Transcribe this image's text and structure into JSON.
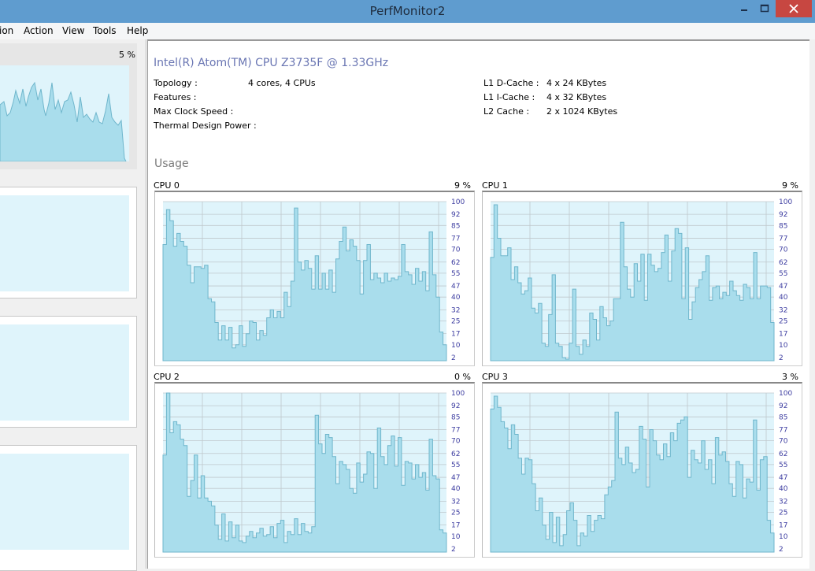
{
  "window": {
    "title": "PerfMonitor2"
  },
  "menu": {
    "items": [
      "ion",
      "Action",
      "View",
      "Tools",
      "Help"
    ]
  },
  "sidebar": {
    "panels": [
      {
        "percent": "5 %"
      }
    ]
  },
  "cpu": {
    "name": "Intel(R) Atom(TM) CPU  Z3735F @ 1.33GHz",
    "specs_left": [
      {
        "label": "Topology :",
        "value": "4 cores, 4 CPUs"
      },
      {
        "label": "Features :",
        "value": ""
      },
      {
        "label": "Max Clock Speed :",
        "value": ""
      },
      {
        "label": "Thermal Design Power :",
        "value": ""
      }
    ],
    "specs_right": [
      {
        "label": "L1 D-Cache :",
        "value": "4 x 24 KBytes"
      },
      {
        "label": "L1 I-Cache :",
        "value": "4 x 32 KBytes"
      },
      {
        "label": "L2 Cache :",
        "value": "2 x 1024 KBytes"
      }
    ]
  },
  "usage": {
    "title": "Usage",
    "y_ticks": [
      "100",
      "92",
      "85",
      "77",
      "70",
      "62",
      "55",
      "47",
      "40",
      "32",
      "25",
      "17",
      "10",
      "2"
    ],
    "cores": [
      {
        "label": "CPU 0",
        "percent": "9 %"
      },
      {
        "label": "CPU 1",
        "percent": "9 %"
      },
      {
        "label": "CPU 2",
        "percent": "0 %"
      },
      {
        "label": "CPU 3",
        "percent": "3 %"
      }
    ]
  },
  "colors": {
    "fill": "#a9ddec",
    "line": "#6fb6cc",
    "bg": "#dff4fb",
    "grid": "#bfc8cc",
    "titlebar": "#5f9ccf",
    "close": "#c74741"
  },
  "chart_data": [
    {
      "type": "area",
      "title": "CPU 0",
      "ylim": [
        0,
        100
      ],
      "y_ticks": [
        100,
        92,
        85,
        77,
        70,
        62,
        55,
        47,
        40,
        32,
        25,
        17,
        10,
        2
      ],
      "values": [
        73,
        95,
        88,
        72,
        80,
        75,
        72,
        60,
        49,
        59,
        59,
        58,
        60,
        39,
        37,
        24,
        13,
        22,
        13,
        21,
        8,
        10,
        22,
        9,
        17,
        25,
        24,
        13,
        19,
        16,
        27,
        32,
        27,
        31,
        27,
        43,
        34,
        50,
        96,
        62,
        57,
        63,
        58,
        45,
        66,
        45,
        55,
        45,
        57,
        43,
        64,
        75,
        84,
        69,
        76,
        72,
        63,
        42,
        63,
        73,
        51,
        55,
        52,
        49,
        55,
        50,
        52,
        51,
        53,
        73,
        56,
        54,
        48,
        58,
        50,
        56,
        44,
        81,
        54,
        40,
        18,
        10
      ]
    },
    {
      "type": "area",
      "title": "CPU 1",
      "ylim": [
        0,
        100
      ],
      "y_ticks": [
        100,
        92,
        85,
        77,
        70,
        62,
        55,
        47,
        40,
        32,
        25,
        17,
        10,
        2
      ],
      "values": [
        65,
        98,
        77,
        66,
        66,
        71,
        51,
        59,
        49,
        42,
        44,
        52,
        33,
        30,
        36,
        11,
        9,
        29,
        54,
        11,
        9,
        2,
        1,
        11,
        45,
        9,
        4,
        13,
        9,
        30,
        26,
        13,
        34,
        27,
        22,
        25,
        39,
        39,
        87,
        59,
        45,
        40,
        61,
        50,
        67,
        38,
        67,
        60,
        56,
        58,
        68,
        79,
        50,
        69,
        83,
        80,
        39,
        71,
        26,
        37,
        46,
        51,
        56,
        66,
        38,
        46,
        47,
        39,
        43,
        41,
        50,
        44,
        41,
        38,
        48,
        46,
        39,
        68,
        39,
        47,
        47,
        46,
        24
      ]
    },
    {
      "type": "area",
      "title": "CPU 2",
      "ylim": [
        0,
        100
      ],
      "y_ticks": [
        100,
        92,
        85,
        77,
        70,
        62,
        55,
        47,
        40,
        32,
        25,
        17,
        10,
        2
      ],
      "values": [
        61,
        102,
        75,
        82,
        80,
        71,
        67,
        35,
        45,
        61,
        34,
        48,
        34,
        32,
        29,
        17,
        8,
        24,
        7,
        19,
        9,
        17,
        7,
        6,
        10,
        13,
        9,
        12,
        15,
        10,
        11,
        16,
        9,
        18,
        20,
        6,
        13,
        11,
        21,
        11,
        18,
        13,
        12,
        16,
        86,
        68,
        62,
        74,
        72,
        60,
        43,
        57,
        55,
        52,
        40,
        37,
        56,
        44,
        49,
        63,
        62,
        40,
        78,
        60,
        55,
        67,
        73,
        54,
        72,
        42,
        57,
        56,
        46,
        55,
        47,
        50,
        39,
        71,
        48,
        46,
        14,
        12
      ]
    },
    {
      "type": "area",
      "title": "CPU 3",
      "ylim": [
        0,
        100
      ],
      "y_ticks": [
        100,
        92,
        85,
        77,
        70,
        62,
        55,
        47,
        40,
        32,
        25,
        17,
        10,
        2
      ],
      "values": [
        90,
        98,
        91,
        82,
        78,
        65,
        80,
        74,
        59,
        49,
        59,
        58,
        43,
        26,
        34,
        17,
        8,
        25,
        6,
        22,
        4,
        11,
        26,
        31,
        20,
        4,
        12,
        10,
        23,
        13,
        20,
        23,
        21,
        36,
        41,
        45,
        88,
        59,
        55,
        66,
        56,
        50,
        52,
        79,
        71,
        41,
        77,
        70,
        61,
        58,
        68,
        60,
        75,
        70,
        81,
        83,
        85,
        47,
        64,
        58,
        56,
        70,
        52,
        58,
        43,
        72,
        61,
        63,
        57,
        43,
        35,
        57,
        55,
        34,
        46,
        44,
        83,
        39,
        58,
        60,
        20,
        12
      ]
    }
  ]
}
